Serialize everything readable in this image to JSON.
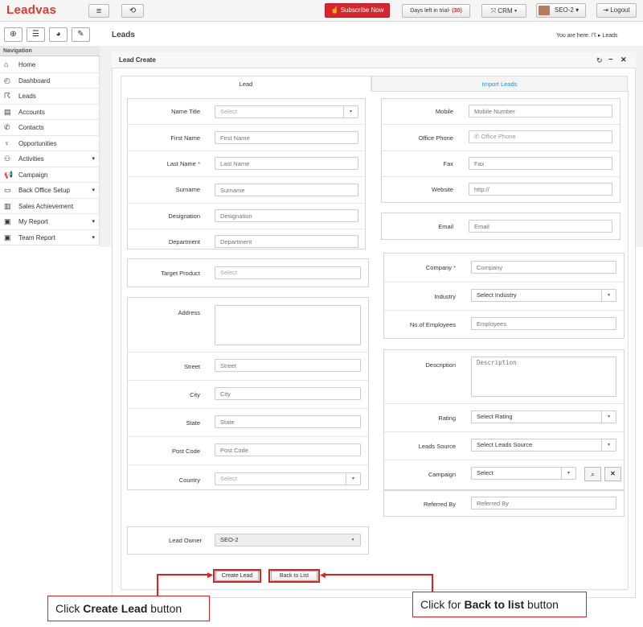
{
  "app": {
    "logo": "Leadvas"
  },
  "topbar": {
    "subscribe": "Subscribe Now",
    "trial_text": "Days left in trial- ",
    "trial_days": "(30)",
    "crm": "CRM",
    "user": "SEO-2",
    "logout": "Logout"
  },
  "nav": {
    "header": "Navigation",
    "items": [
      {
        "label": "Home",
        "icon": "home-icon"
      },
      {
        "label": "Dashboard",
        "icon": "dashboard-icon"
      },
      {
        "label": "Leads",
        "icon": "leads-icon"
      },
      {
        "label": "Accounts",
        "icon": "accounts-icon"
      },
      {
        "label": "Contacts",
        "icon": "phone-icon"
      },
      {
        "label": "Opportunities",
        "icon": "opportunities-icon"
      },
      {
        "label": "Activities",
        "icon": "activities-icon",
        "caret": "▾"
      },
      {
        "label": "Campaign",
        "icon": "megaphone-icon"
      },
      {
        "label": "Back Office Setup",
        "icon": "back-office-icon",
        "caret": "▾"
      },
      {
        "label": "Sales Achievement",
        "icon": "sales-achievement-icon"
      },
      {
        "label": "My Report",
        "icon": "report-icon",
        "caret": "▾"
      },
      {
        "label": "Team Report",
        "icon": "team-report-icon",
        "caret": "▾"
      }
    ]
  },
  "header": {
    "title": "Leads",
    "crumb_prefix": "You are here:",
    "crumb_item": "Leads"
  },
  "panel": {
    "title": "Lead Create",
    "tabs": [
      "Lead",
      "Import Leads"
    ]
  },
  "form": {
    "name_title": {
      "label": "Name Title",
      "placeholder": "Select"
    },
    "first_name": {
      "label": "First Name",
      "placeholder": "First Name"
    },
    "last_name": {
      "label": "Last Name",
      "placeholder": "Last Name",
      "required": "*"
    },
    "surname": {
      "label": "Surname",
      "placeholder": "Surname"
    },
    "designation": {
      "label": "Designation",
      "placeholder": "Designation"
    },
    "department": {
      "label": "Department",
      "placeholder": "Department"
    },
    "target_product": {
      "label": "Target Product",
      "placeholder": "Select"
    },
    "address": {
      "label": "Address",
      "placeholder": ""
    },
    "street": {
      "label": "Street",
      "placeholder": "Street"
    },
    "city": {
      "label": "City",
      "placeholder": "City"
    },
    "state": {
      "label": "State",
      "placeholder": "State"
    },
    "post_code": {
      "label": "Post Code",
      "placeholder": "Post Code"
    },
    "country": {
      "label": "Country",
      "placeholder": "Select"
    },
    "lead_owner": {
      "label": "Lead Owner",
      "value": "SEO-2"
    },
    "mobile": {
      "label": "Mobile",
      "placeholder": "Mobile Number"
    },
    "office_phone": {
      "label": "Office Phone",
      "placeholder": "Office Phone"
    },
    "fax": {
      "label": "Fax",
      "placeholder": "Fax"
    },
    "website": {
      "label": "Website",
      "placeholder": "http://"
    },
    "email": {
      "label": "Email",
      "placeholder": "Email"
    },
    "company": {
      "label": "Company",
      "placeholder": "Company",
      "required": "*"
    },
    "industry": {
      "label": "Industry",
      "value": "Select Industry"
    },
    "employees": {
      "label": "No.of Employees",
      "placeholder": "Employees"
    },
    "description": {
      "label": "Description",
      "placeholder": "Description"
    },
    "rating": {
      "label": "Rating",
      "value": "Select Rating"
    },
    "leads_source": {
      "label": "Leads Source",
      "value": "Select Leads Source"
    },
    "campaign": {
      "label": "Campaign",
      "value": "Select"
    },
    "referred_by": {
      "label": "Referred By",
      "placeholder": "Referred By"
    }
  },
  "buttons": {
    "create": "Create Lead",
    "back": "Back to List"
  },
  "callouts": {
    "left_pre": "Click ",
    "left_bold": "Create Lead",
    "left_post": " button",
    "right_pre": "Click for ",
    "right_bold": "Back to list",
    "right_post": "  button"
  }
}
